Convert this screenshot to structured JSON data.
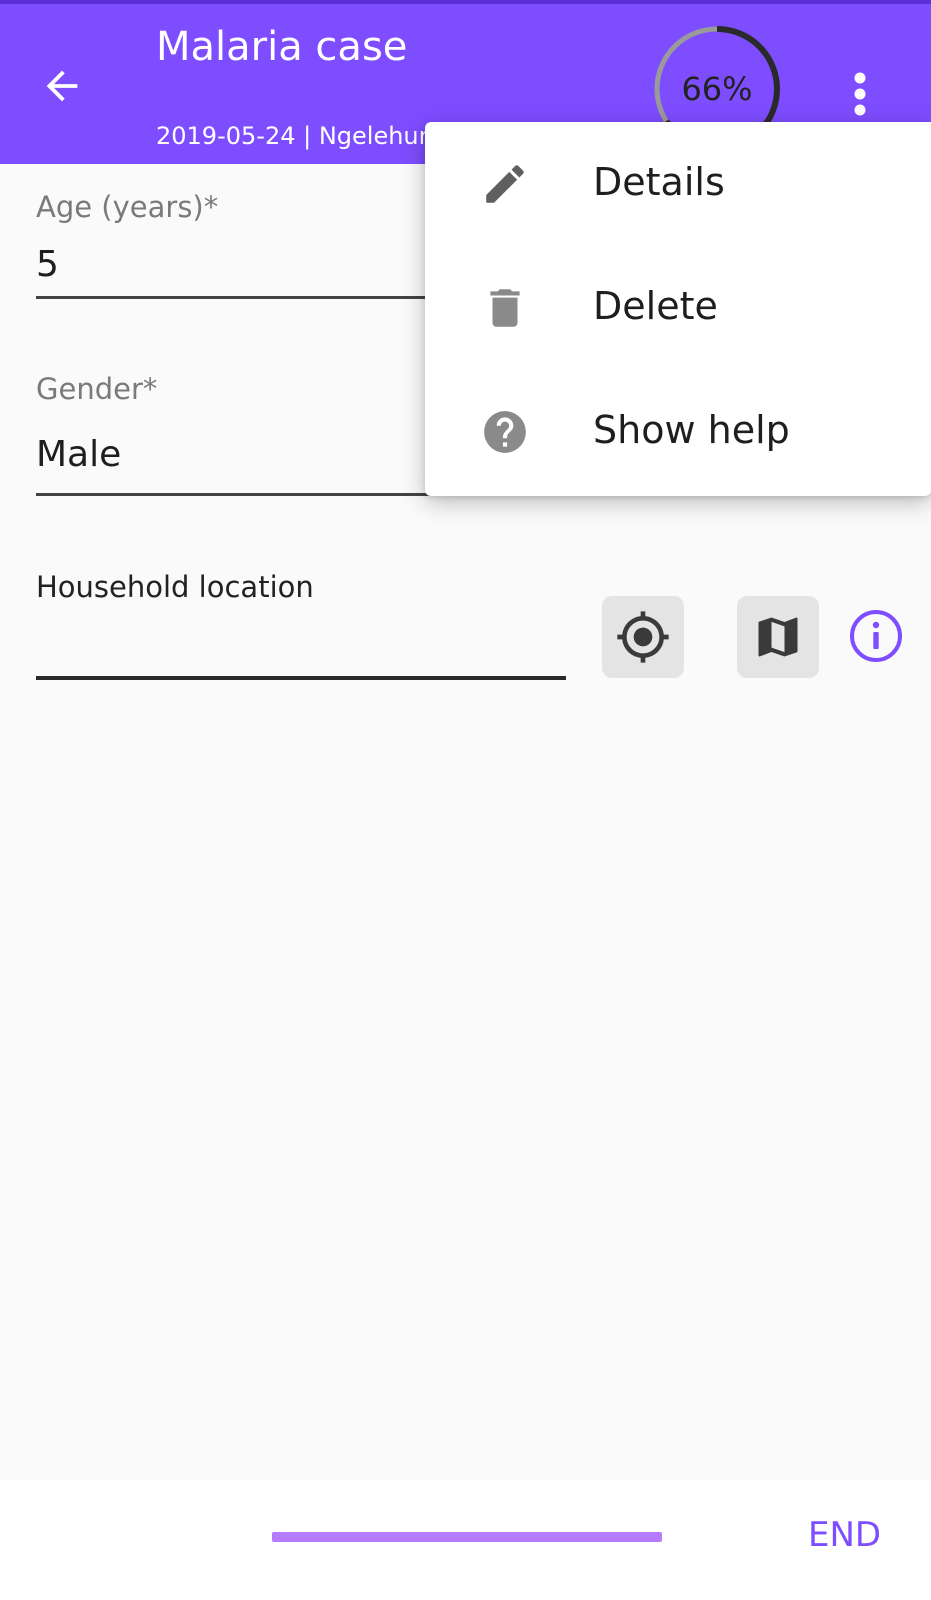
{
  "app_bar": {
    "title": "Malaria case",
    "subtitle": "2019-05-24 | Ngelehun",
    "progress_percent": 66,
    "progress_label": "66%",
    "background_color": "#7e4dff"
  },
  "icons": {
    "back": "arrow-left-icon",
    "more": "more-vert-icon",
    "gps": "gps-target-icon",
    "map": "map-icon",
    "info": "info-icon",
    "edit": "pencil-icon",
    "delete": "trash-icon",
    "help": "help-circle-icon"
  },
  "form": {
    "age": {
      "label": "Age (years)*",
      "value": "5"
    },
    "gender": {
      "label": "Gender*",
      "value": "Male"
    },
    "household_location": {
      "label": "Household location",
      "value": ""
    }
  },
  "menu": {
    "items": [
      {
        "label": "Details",
        "icon": "pencil-icon"
      },
      {
        "label": "Delete",
        "icon": "trash-icon"
      },
      {
        "label": "Show help",
        "icon": "help-circle-icon"
      }
    ]
  },
  "bottom": {
    "end_label": "END",
    "accent_color": "#7e4dff",
    "progress_color": "#b57cff"
  }
}
